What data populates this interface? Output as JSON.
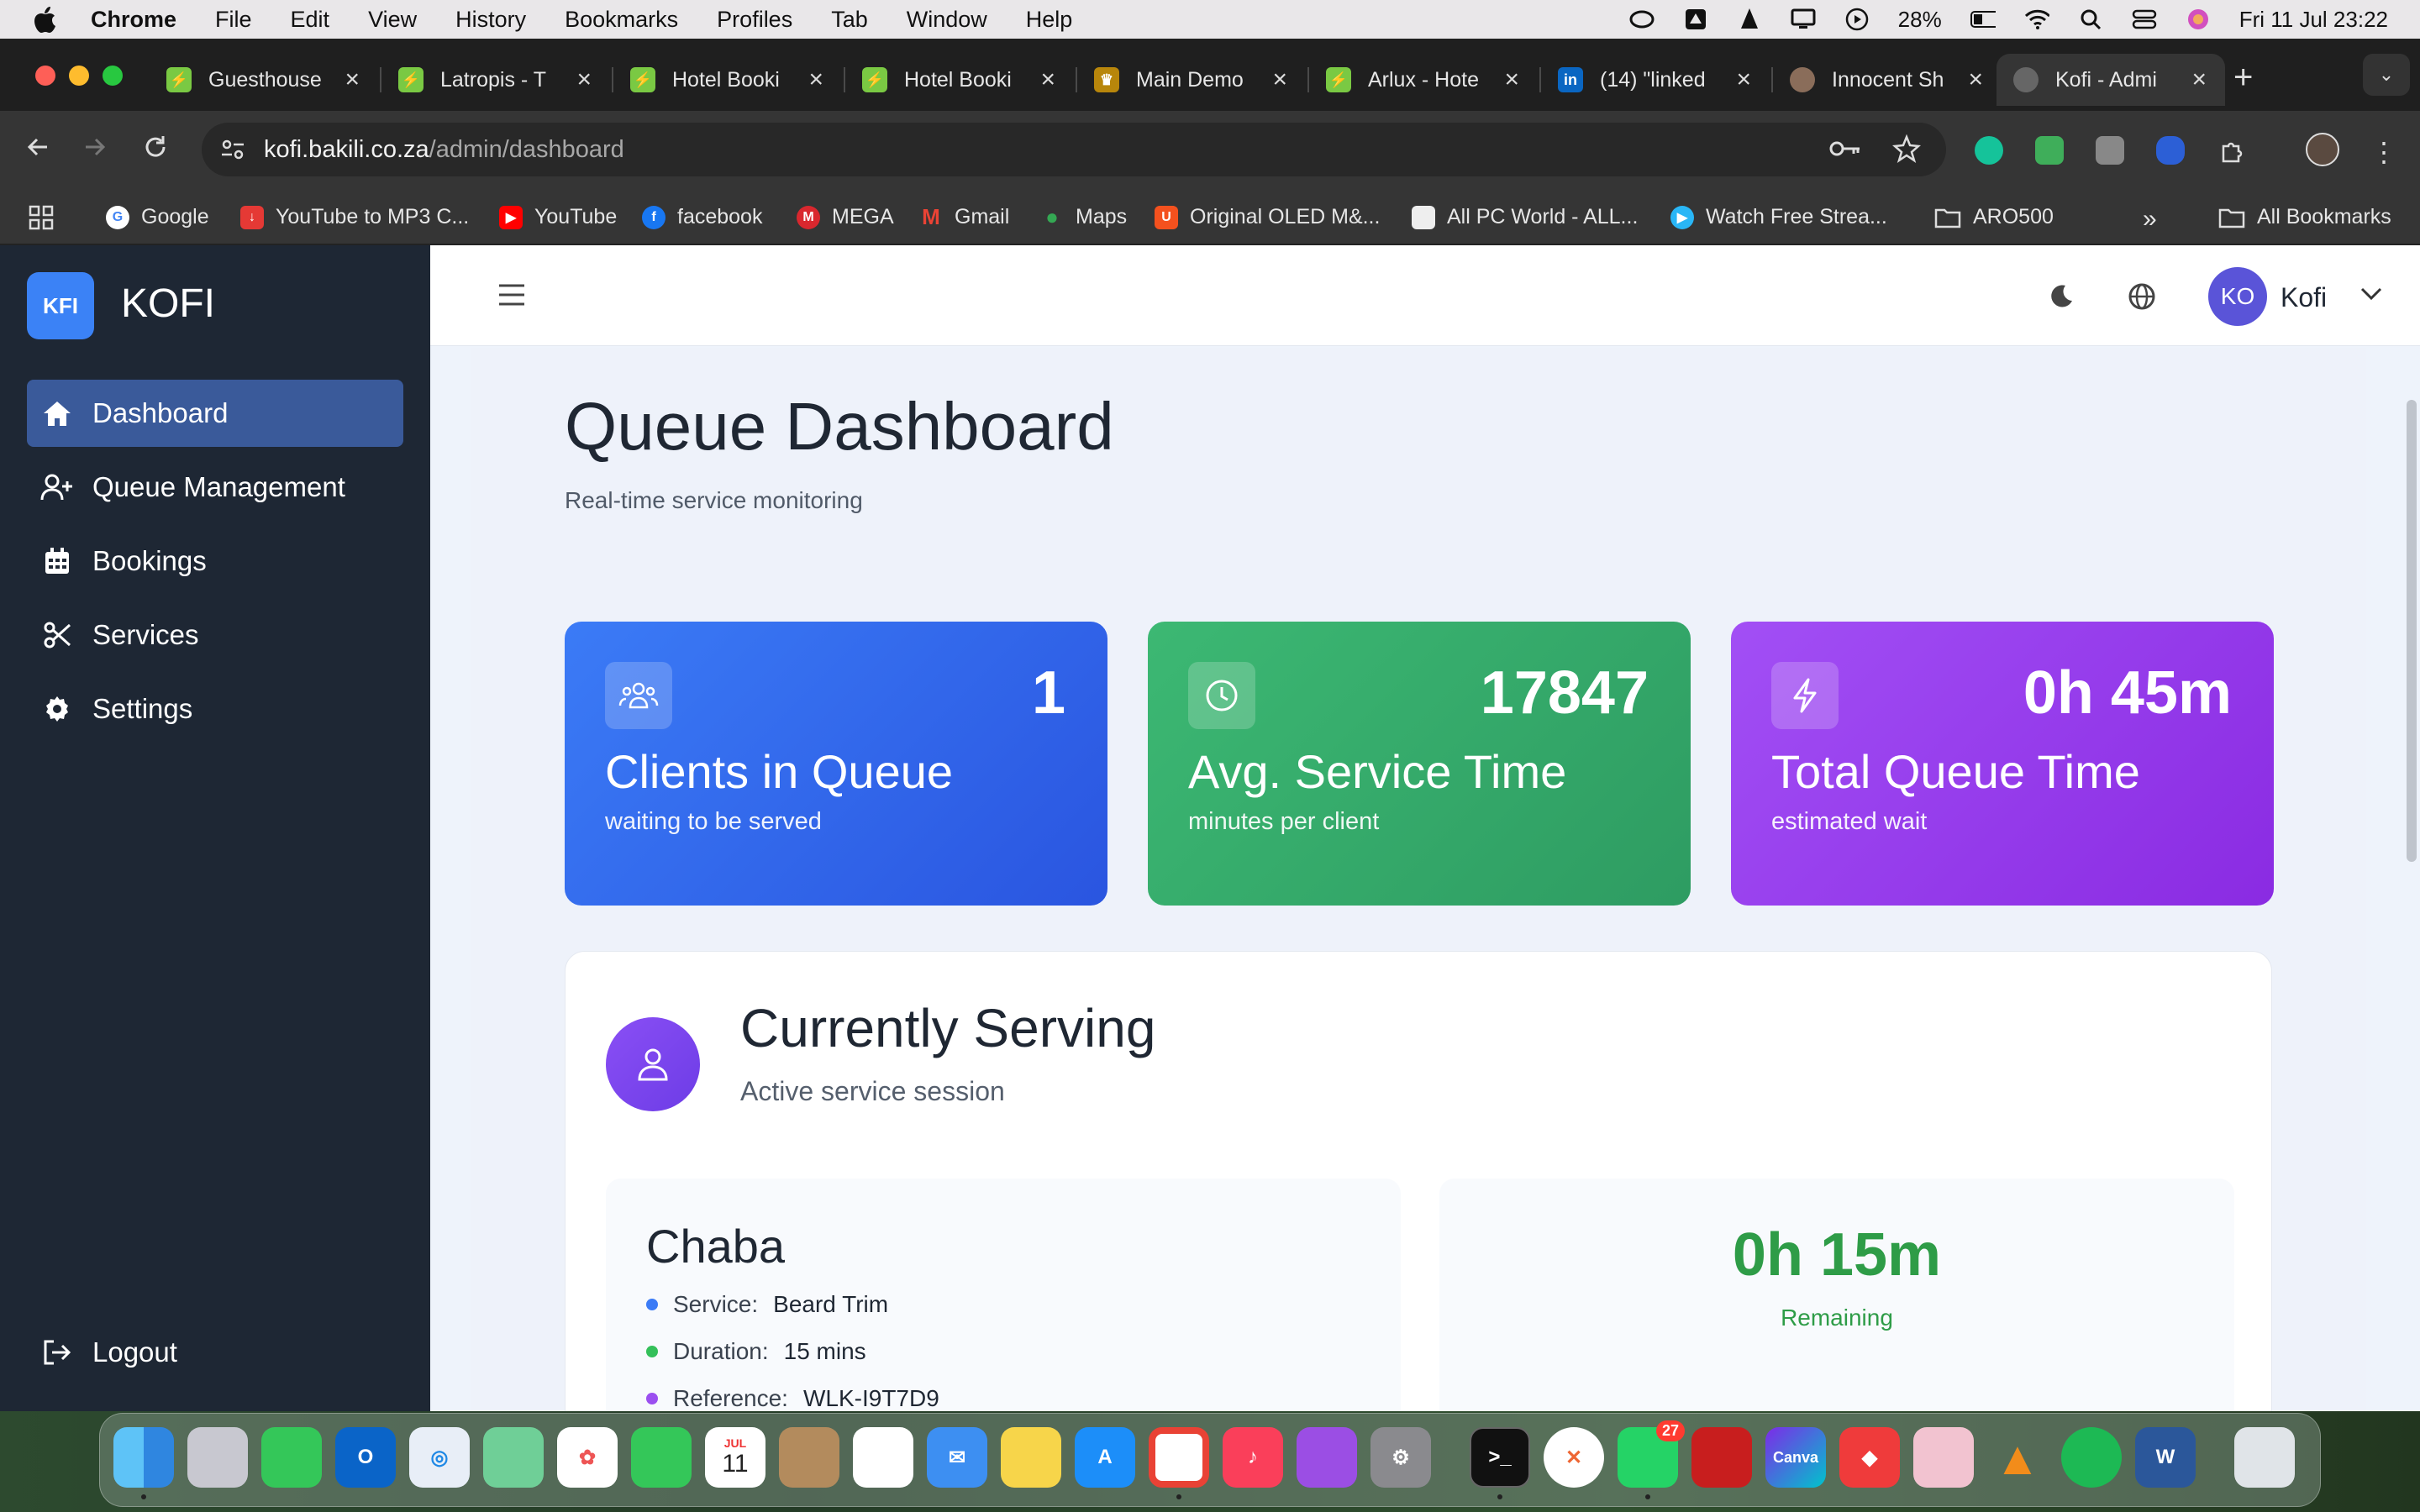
{
  "menubar": {
    "app": "Chrome",
    "items": [
      "File",
      "Edit",
      "View",
      "History",
      "Bookmarks",
      "Profiles",
      "Tab",
      "Window",
      "Help"
    ],
    "battery": "28%",
    "datetime": "Fri 11 Jul  23:22"
  },
  "browser": {
    "tabs": [
      {
        "title": "Guesthouse",
        "color": "#7ac943"
      },
      {
        "title": "Latropis - T",
        "color": "#7ac943"
      },
      {
        "title": "Hotel Booki",
        "color": "#7ac943"
      },
      {
        "title": "Hotel Booki",
        "color": "#7ac943"
      },
      {
        "title": "Main Demo",
        "color": "#b8860b"
      },
      {
        "title": "Arlux - Hote",
        "color": "#7ac943"
      },
      {
        "title": "(14) \"linked",
        "color": "#0a66c2"
      },
      {
        "title": "Innocent Sh",
        "color": "#8a6d5a"
      },
      {
        "title": "Kofi - Admi",
        "color": "#666"
      }
    ],
    "url_host": "kofi.bakili.co.za",
    "url_path": "/admin/dashboard",
    "bookmarks": [
      "Google",
      "YouTube to MP3 C...",
      "YouTube",
      "facebook",
      "MEGA",
      "Gmail",
      "Maps",
      "Original OLED M&...",
      "All PC World - ALL...",
      "Watch Free Strea...",
      "ARO500"
    ],
    "all_bookmarks": "All Bookmarks"
  },
  "app": {
    "logo": "KFI",
    "brand": "KOFI",
    "nav": [
      "Dashboard",
      "Queue Management",
      "Bookings",
      "Services",
      "Settings"
    ],
    "logout": "Logout",
    "user_initials": "KO",
    "user_name": "Kofi"
  },
  "dashboard": {
    "title": "Queue Dashboard",
    "subtitle": "Real-time service monitoring",
    "cards": [
      {
        "value": "1",
        "title": "Clients in Queue",
        "sub": "waiting to be served"
      },
      {
        "value": "17847",
        "title": "Avg. Service Time",
        "sub": "minutes per client"
      },
      {
        "value": "0h 45m",
        "title": "Total Queue Time",
        "sub": "estimated wait"
      }
    ],
    "serving": {
      "title": "Currently Serving",
      "subtitle": "Active service session",
      "client": "Chaba",
      "service_label": "Service:",
      "service": "Beard Trim",
      "duration_label": "Duration:",
      "duration": "15 mins",
      "reference_label": "Reference:",
      "reference": "WLK-I9T7D9",
      "remaining": "0h 15m",
      "remaining_label": "Remaining"
    }
  },
  "dock": {
    "whatsapp_badge": "27",
    "calendar_month": "JUL",
    "calendar_day": "11"
  }
}
